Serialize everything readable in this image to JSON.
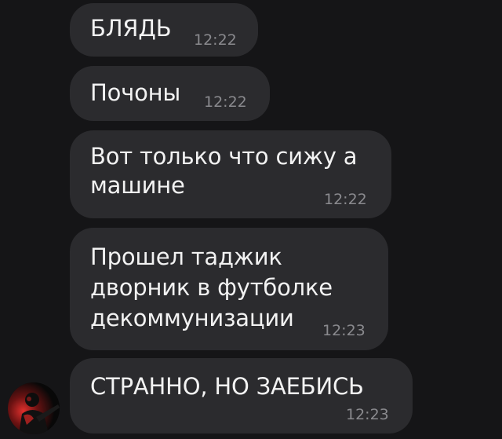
{
  "messages": [
    {
      "text": "БЛЯДЬ",
      "time": "12:22"
    },
    {
      "text": "Почоны",
      "time": "12:22"
    },
    {
      "text": "Вот только что сижу а\nмашине",
      "time": "12:22"
    },
    {
      "text": "Прошел таджик\nдворник в футболке\nдекоммунизации",
      "time": "12:23"
    },
    {
      "text": "СТРАННО, НО ЗАЕБИСЬ",
      "time": "12:23"
    }
  ],
  "colors": {
    "background": "#151517",
    "bubble": "#2b2b2e",
    "text": "#f2f2f2",
    "timestamp": "#8a8a8e",
    "avatar_accent": "#d62a2a"
  },
  "avatar_icon": "user-avatar-photo"
}
